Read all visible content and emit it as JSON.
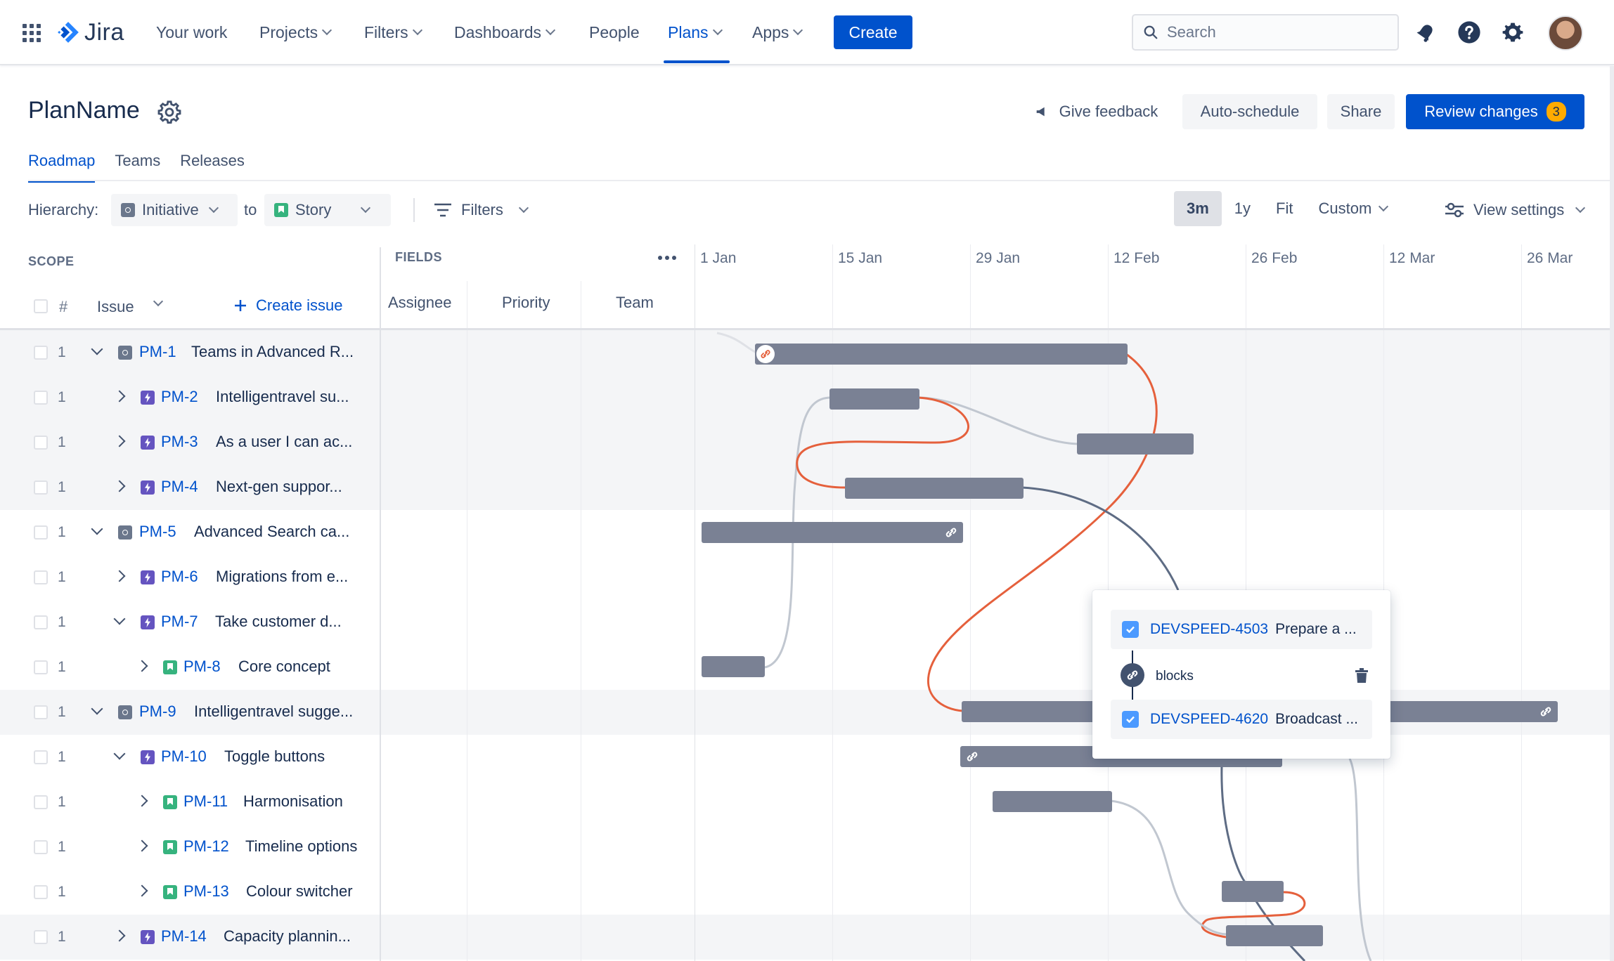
{
  "nav": {
    "logo": "Jira",
    "items": [
      {
        "label": "Your work",
        "has_menu": false
      },
      {
        "label": "Projects",
        "has_menu": true
      },
      {
        "label": "Filters",
        "has_menu": true
      },
      {
        "label": "Dashboards",
        "has_menu": true
      },
      {
        "label": "People",
        "has_menu": false
      },
      {
        "label": "Plans",
        "has_menu": true
      },
      {
        "label": "Apps",
        "has_menu": true
      }
    ],
    "create_label": "Create",
    "search_placeholder": "Search",
    "icons": [
      "notifications-icon",
      "help-icon",
      "settings-icon"
    ]
  },
  "header": {
    "plan_name": "PlanName",
    "feedback_label": "Give feedback",
    "auto_schedule_label": "Auto-schedule",
    "share_label": "Share",
    "review_label": "Review changes",
    "review_count": "3"
  },
  "tabs": [
    "Roadmap",
    "Teams",
    "Releases"
  ],
  "toolbar": {
    "hierarchy_label": "Hierarchy:",
    "from_level": "Initiative",
    "to_label": "to",
    "to_level": "Story",
    "filters_label": "Filters",
    "zoom": [
      "3m",
      "1y",
      "Fit",
      "Custom"
    ],
    "zoom_active": "3m",
    "view_settings_label": "View settings"
  },
  "grid": {
    "scope_label": "SCOPE",
    "fields_label": "FIELDS",
    "hash_label": "#",
    "issue_label": "Issue",
    "create_issue_label": "Create issue",
    "columns": [
      "Assignee",
      "Priority",
      "Team"
    ],
    "dates": [
      "1 Jan",
      "15 Jan",
      "29 Jan",
      "12 Feb",
      "26 Feb",
      "12 Mar",
      "26 Mar"
    ]
  },
  "rows": [
    {
      "num": "1",
      "key": "PM-1",
      "summary": "Teams in Advanced R...",
      "type": "initiative",
      "level": 0,
      "expand": "down"
    },
    {
      "num": "1",
      "key": "PM-2",
      "summary": "Intelligentravel su...",
      "type": "epic",
      "level": 1,
      "expand": "right"
    },
    {
      "num": "1",
      "key": "PM-3",
      "summary": "As a user I can ac...",
      "type": "epic",
      "level": 1,
      "expand": "right"
    },
    {
      "num": "1",
      "key": "PM-4",
      "summary": "Next-gen suppor...",
      "type": "epic",
      "level": 1,
      "expand": "right"
    },
    {
      "num": "1",
      "key": "PM-5",
      "summary": "Advanced Search ca...",
      "type": "initiative",
      "level": 0,
      "expand": "down"
    },
    {
      "num": "1",
      "key": "PM-6",
      "summary": "Migrations from e...",
      "type": "epic",
      "level": 1,
      "expand": "right"
    },
    {
      "num": "1",
      "key": "PM-7",
      "summary": "Take customer d...",
      "type": "epic",
      "level": 1,
      "expand": "down"
    },
    {
      "num": "1",
      "key": "PM-8",
      "summary": "Core concept",
      "type": "story",
      "level": 2,
      "expand": "right"
    },
    {
      "num": "1",
      "key": "PM-9",
      "summary": "Intelligentravel sugge...",
      "type": "initiative",
      "level": 0,
      "expand": "down"
    },
    {
      "num": "1",
      "key": "PM-10",
      "summary": "Toggle buttons",
      "type": "epic",
      "level": 1,
      "expand": "down"
    },
    {
      "num": "1",
      "key": "PM-11",
      "summary": "Harmonisation",
      "type": "story",
      "level": 2,
      "expand": "right"
    },
    {
      "num": "1",
      "key": "PM-12",
      "summary": "Timeline options",
      "type": "story",
      "level": 2,
      "expand": "right"
    },
    {
      "num": "1",
      "key": "PM-13",
      "summary": "Colour switcher",
      "type": "story",
      "level": 2,
      "expand": "right"
    },
    {
      "num": "1",
      "key": "PM-14",
      "summary": "Capacity plannin...",
      "type": "epic",
      "level": 1,
      "expand": "right"
    }
  ],
  "popup": {
    "from_key": "DEVSPEED-4503",
    "from_summary": "Prepare a ...",
    "relation": "blocks",
    "to_key": "DEVSPEED-4620",
    "to_summary": "Broadcast ..."
  },
  "colors": {
    "brand": "#0052cc",
    "bar": "#7a8194",
    "dependency_conflict": "#e5603c",
    "dependency_ok": "#c1c7d0",
    "dependency_selected": "#5e6c84",
    "badge": "#ffab00"
  }
}
